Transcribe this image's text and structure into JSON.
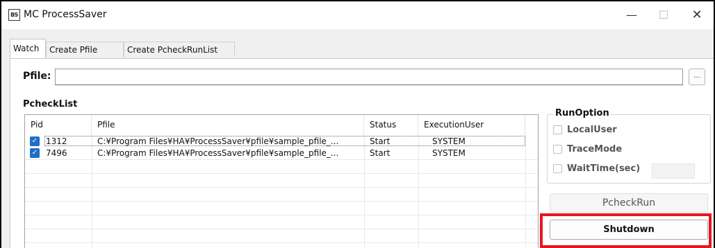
{
  "window": {
    "app_icon_text": "BS",
    "title": "MC ProcessSaver",
    "minimize_glyph": "—",
    "maximize_glyph": "☐",
    "close_glyph": "✕"
  },
  "tabs": [
    {
      "label": "Watch",
      "active": true
    },
    {
      "label": "Create Pfile",
      "active": false
    },
    {
      "label": "Create PcheckRunList",
      "active": false
    }
  ],
  "pfile": {
    "label": "Pfile:",
    "value": "",
    "browse_label": "..."
  },
  "pchecklist": {
    "title": "PcheckList",
    "columns": [
      "Pid",
      "Pfile",
      "Status",
      "ExecutionUser"
    ],
    "rows": [
      {
        "checked": true,
        "pid": "1312",
        "pfile": "C:¥Program Files¥HA¥ProcessSaver¥pfile¥sample_pfile_...",
        "status": "Start",
        "user": "SYSTEM"
      },
      {
        "checked": true,
        "pid": "7496",
        "pfile": "C:¥Program Files¥HA¥ProcessSaver¥pfile¥sample_pfile_...",
        "status": "Start",
        "user": "SYSTEM"
      }
    ]
  },
  "run_option": {
    "title": "RunOption",
    "local_user": {
      "label": "LocalUser",
      "checked": false
    },
    "trace_mode": {
      "label": "TraceMode",
      "checked": false
    },
    "wait_time": {
      "label": "WaitTime(sec)",
      "checked": false,
      "value": ""
    }
  },
  "buttons": {
    "pcheck_run": "PcheckRun",
    "shutdown": "Shutdown"
  },
  "colors": {
    "highlight": "#e8141e",
    "checkbox_checked": "#1f6fc8"
  }
}
